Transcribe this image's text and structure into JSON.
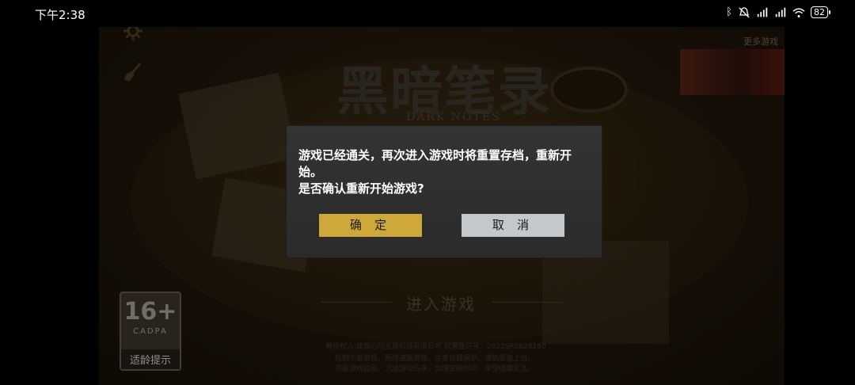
{
  "status_bar": {
    "time": "下午2:38",
    "battery": "82",
    "icons": [
      "bluetooth-icon",
      "mute-icon",
      "signal-hd-1-icon",
      "signal-hd-2-icon",
      "wifi-icon",
      "battery-icon"
    ]
  },
  "game": {
    "title": "黑暗笔录",
    "subtitle": "DARK NOTES",
    "settings_icon": "gear-icon",
    "clean_icon": "broom-icon",
    "more_games_label": "更多游戏",
    "enter_game": "进入游戏",
    "copyright": "著作权人:成都心动互娱科技有限公司      软著登记号：2022SR0628188",
    "tips_line1": "抵制不良游戏，拒绝盗版游戏，注意自我保护，谨防受骗上当。",
    "tips_line2": "适度游戏益脑，沉迷游戏伤身，合理安排时间，享受健康生活。",
    "age_rating": {
      "number": "16+",
      "org": "CADPA",
      "label": "适龄提示"
    }
  },
  "dialog": {
    "message_line1": "游戏已经通关，再次进入游戏时将重置存档，重新开",
    "message_line2": "始。",
    "message_line3": "是否确认重新开始游戏?",
    "confirm_label": "确 定",
    "cancel_label": "取 消"
  },
  "colors": {
    "confirm_button": "#cfa83c",
    "cancel_button": "#c2c8cc",
    "dialog_bg": "#2f2f2f"
  }
}
